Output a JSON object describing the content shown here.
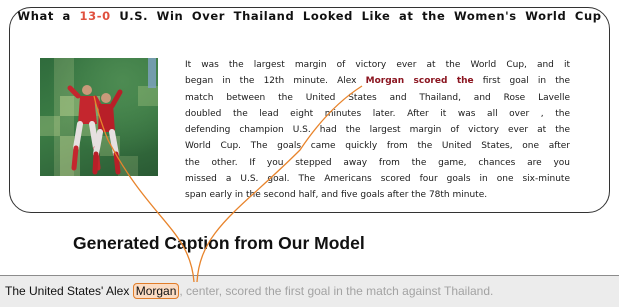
{
  "title": {
    "before": "What a ",
    "score": "13-0",
    "after": " U.S. Win Over Thailand Looked Like at the Women's World Cup"
  },
  "article": {
    "lines": [
      [
        "It was the largest margin of victory ever at the World Cup, and it",
        "",
        ""
      ],
      [
        "began in the 12th minute. Alex ",
        "Morgan scored the",
        " first goal in the"
      ],
      [
        "match between the United States and Thailand, and Rose Lavelle",
        "",
        ""
      ],
      [
        "doubled the lead eight minutes later. After it was all over , the",
        "",
        ""
      ],
      [
        "defending champion U.S. had the largest margin of victory ever at the",
        "",
        ""
      ],
      [
        "World Cup. The goals came quickly from the United States, one after",
        "",
        ""
      ],
      [
        "the other. If you stepped away from the game, chances are you",
        "",
        ""
      ],
      [
        "missed a U.S. goal. The Americans scored four goals in one six-minute",
        "",
        ""
      ],
      [
        "span early in the second half, and five goals after the 78th minute.",
        "",
        ""
      ]
    ]
  },
  "subheading": "Generated Caption from Our Model",
  "caption": {
    "before": "The United States' Alex ",
    "highlight": "Morgan",
    "after": ", center, scored the first goal in the match against Thailand."
  },
  "colors": {
    "connector": "#e8842c",
    "highlight_text": "#8b1520",
    "score": "#e0513f"
  }
}
